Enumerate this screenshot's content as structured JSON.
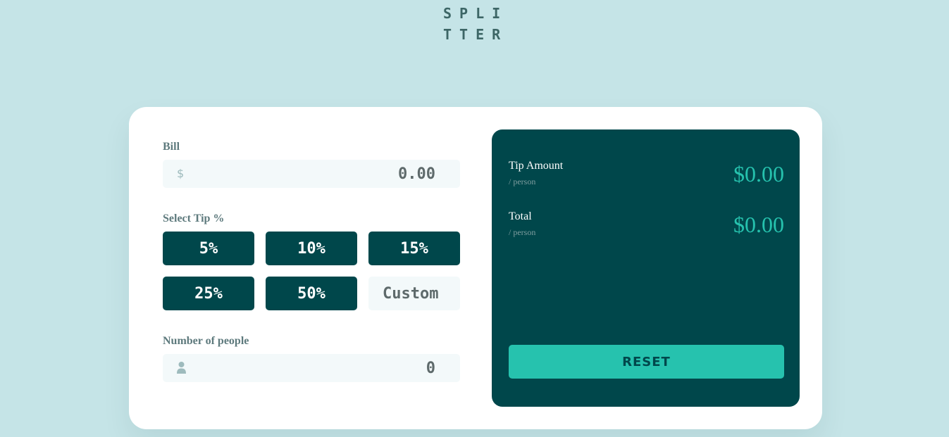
{
  "logo": {
    "line1": "SPLI",
    "line2": "TTER"
  },
  "bill": {
    "label": "Bill",
    "prefix": "$",
    "placeholder": "0.00"
  },
  "tip": {
    "label": "Select Tip %",
    "options": [
      "5%",
      "10%",
      "15%",
      "25%",
      "50%"
    ],
    "custom_placeholder": "Custom"
  },
  "people": {
    "label": "Number of people",
    "placeholder": "0",
    "icon": "person-icon"
  },
  "result": {
    "tip_amount": {
      "title": "Tip Amount",
      "sub": "/ person",
      "value": "$0.00"
    },
    "total": {
      "title": "Total",
      "sub": "/ person",
      "value": "$0.00"
    },
    "reset_label": "RESET"
  },
  "colors": {
    "background": "#c5e4e7",
    "dark_cyan": "#00474b",
    "accent": "#26c2ae",
    "input_bg": "#f3f9fa"
  }
}
